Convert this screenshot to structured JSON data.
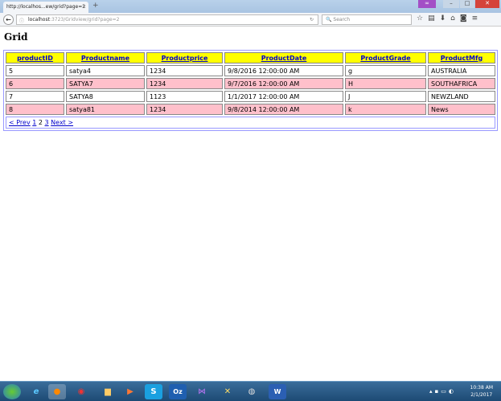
{
  "browser": {
    "tab_title": "http://localhos...ew/grid?page=2",
    "url_host": "localhost",
    "url_rest": ":3723/Gridview/grid?page=2",
    "search_placeholder": "Search"
  },
  "page": {
    "title": "Grid"
  },
  "grid": {
    "headers": [
      "productID",
      "Productname",
      "Productprice",
      "ProductDate",
      "ProductGrade",
      "ProductMfg"
    ],
    "rows": [
      [
        "5",
        "satya4",
        "1234",
        "9/8/2016 12:00:00 AM",
        "g",
        "AUSTRALIA"
      ],
      [
        "6",
        "SATYA7",
        "1234",
        "9/7/2016 12:00:00 AM",
        "H",
        "SOUTHAFRICA"
      ],
      [
        "7",
        "SATYA8",
        "1123",
        "1/1/2017 12:00:00 AM",
        "J",
        "NEWZLAND"
      ],
      [
        "8",
        "satya81",
        "1234",
        "9/8/2014 12:00:00 AM",
        "k",
        "News"
      ]
    ],
    "pager": {
      "prev": "< Prev",
      "pages": [
        "1",
        "2",
        "3"
      ],
      "next": "Next >"
    },
    "colors": {
      "header": "#ffff00",
      "alt_row": "#ffc0cb"
    }
  },
  "taskbar": {
    "time": "10:38 AM",
    "date": "2/1/2017"
  }
}
